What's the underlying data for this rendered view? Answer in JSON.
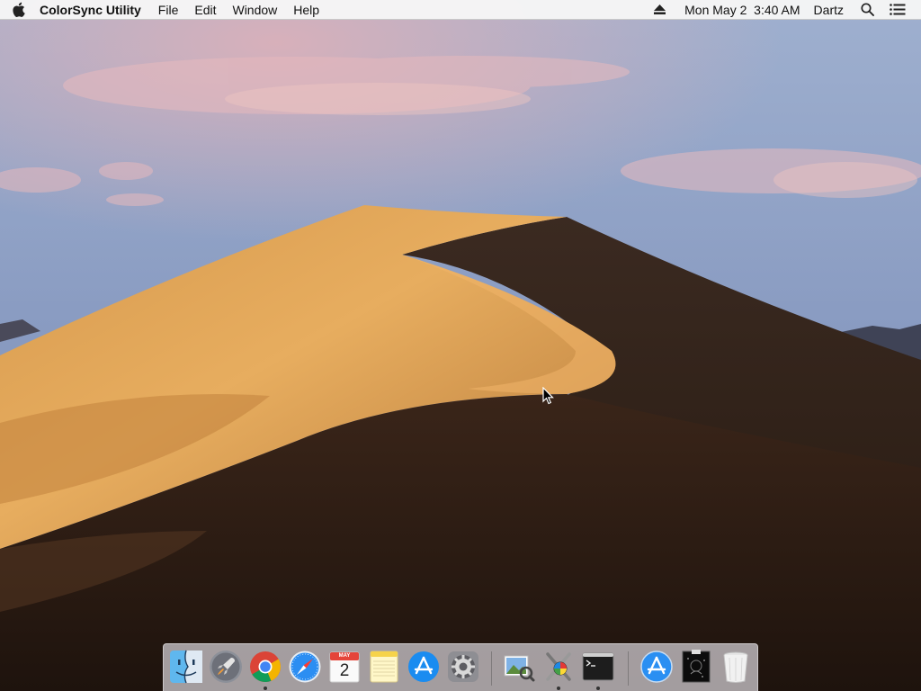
{
  "menubar": {
    "app_name": "ColorSync Utility",
    "menus": [
      "File",
      "Edit",
      "Window",
      "Help"
    ],
    "clock": "Mon May 2  3:40 AM",
    "user": "Dartz",
    "icons": [
      "apple-logo-icon",
      "eject-icon",
      "spotlight-search-icon",
      "notification-center-icon"
    ]
  },
  "dock": {
    "apps": [
      {
        "name": "Finder",
        "icon": "finder-icon",
        "running": false
      },
      {
        "name": "Launchpad",
        "icon": "launchpad-rocket-icon",
        "running": false
      },
      {
        "name": "Google Chrome",
        "icon": "chrome-icon",
        "running": true
      },
      {
        "name": "Safari",
        "icon": "safari-compass-icon",
        "running": false
      },
      {
        "name": "Calendar",
        "icon": "calendar-icon",
        "running": false,
        "month": "MAY",
        "day": "2"
      },
      {
        "name": "Notes",
        "icon": "notes-icon",
        "running": false
      },
      {
        "name": "App Store",
        "icon": "app-store-icon",
        "running": false
      },
      {
        "name": "System Preferences",
        "icon": "gear-icon",
        "running": false
      },
      {
        "name": "Preview",
        "icon": "preview-icon",
        "running": false
      },
      {
        "name": "ColorSync Utility",
        "icon": "colorsync-utility-icon",
        "running": true
      },
      {
        "name": "Terminal",
        "icon": "terminal-icon",
        "running": true
      },
      {
        "name": "App Store Download",
        "icon": "app-store-download-icon",
        "running": false
      },
      {
        "name": "Document",
        "icon": "document-thumbnail-icon",
        "running": false
      },
      {
        "name": "Trash",
        "icon": "trash-icon",
        "running": false
      }
    ]
  },
  "colors": {
    "sky_top": "#a7b6d2",
    "sky_bottom": "#7f93bb",
    "sand_light": "#e0a554",
    "sand_mid": "#c0843f",
    "sand_shadow": "#2f211a"
  }
}
